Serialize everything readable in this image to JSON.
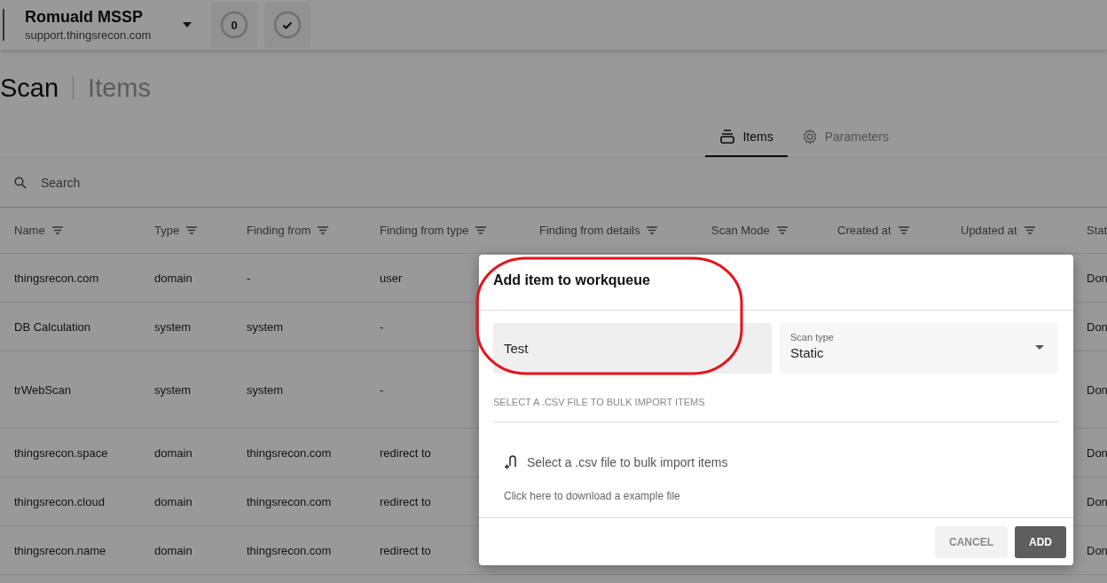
{
  "header": {
    "org_name": "Romuald MSSP",
    "org_domain": "support.thingsrecon.com",
    "counter": "0"
  },
  "breadcrumb": {
    "title": "Scan",
    "subtitle": "Items"
  },
  "tabs": [
    {
      "label": "Items",
      "kind": "items",
      "selected": true
    },
    {
      "label": "Parameters",
      "kind": "parameters",
      "selected": false
    }
  ],
  "search": {
    "placeholder": "Search"
  },
  "table": {
    "columns": [
      "Name",
      "Type",
      "Finding from",
      "Finding from type",
      "Finding from details",
      "Scan Mode",
      "Created at",
      "Updated at",
      "Stat"
    ],
    "rows": [
      {
        "name": "thingsrecon.com",
        "type": "domain",
        "finding_from": "-",
        "finding_from_type": "user",
        "status": "Don",
        "tall": false
      },
      {
        "name": "DB Calculation",
        "type": "system",
        "finding_from": "system",
        "finding_from_type": "-",
        "status": "Don",
        "tall": false
      },
      {
        "name": "trWebScan",
        "type": "system",
        "finding_from": "system",
        "finding_from_type": "-",
        "status": "Don",
        "tall": true
      },
      {
        "name": "thingsrecon.space",
        "type": "domain",
        "finding_from": "thingsrecon.com",
        "finding_from_type": "redirect to",
        "status": "Don",
        "tall": false
      },
      {
        "name": "thingsrecon.cloud",
        "type": "domain",
        "finding_from": "thingsrecon.com",
        "finding_from_type": "redirect to",
        "status": "Don",
        "tall": false
      },
      {
        "name": "thingsrecon.name",
        "type": "domain",
        "finding_from": "thingsrecon.com",
        "finding_from_type": "redirect to",
        "status": "Don",
        "tall": false
      }
    ]
  },
  "dialog": {
    "title": "Add item to workqueue",
    "item_value": "Test",
    "scan_type": {
      "label": "Scan type",
      "value": "Static"
    },
    "bulk_section": "SELECT A .CSV FILE TO BULK IMPORT ITEMS",
    "file_picker": "Select a .csv file to bulk import items",
    "example_link": "Click here to download a example file",
    "buttons": [
      {
        "label": "CANCEL",
        "disabled": true
      },
      {
        "label": "ADD",
        "disabled": false
      }
    ]
  }
}
